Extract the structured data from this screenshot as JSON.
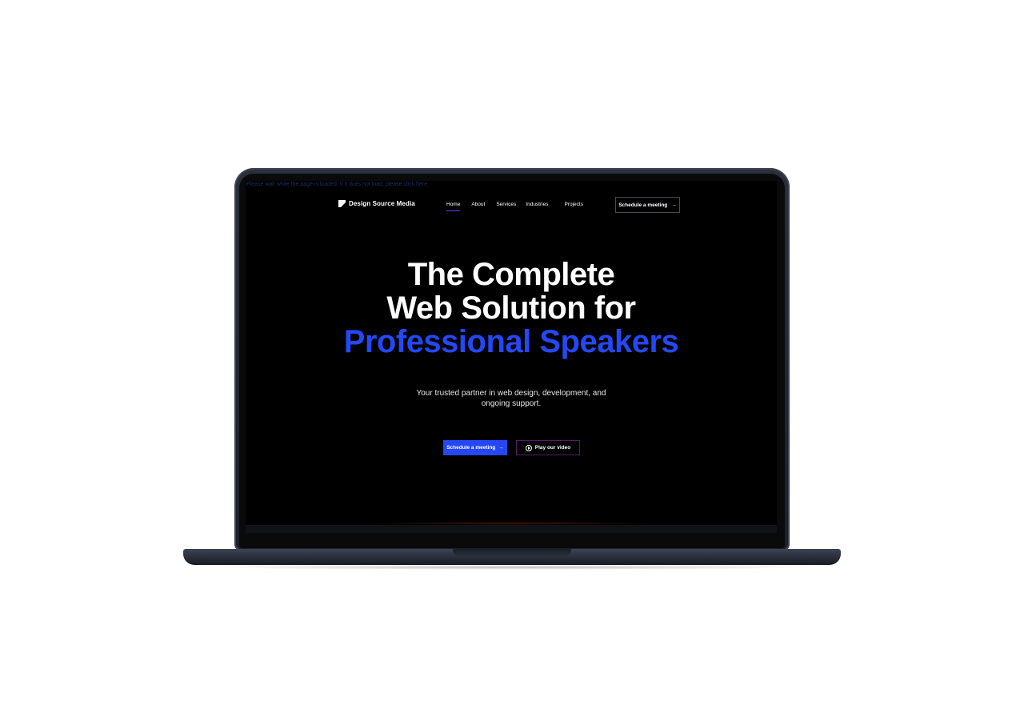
{
  "notice": "Please wait while the page is loaded. If it does not load, please click here.",
  "brand": {
    "name": "Design Source Media",
    "logo_icon": "logo-mark-icon"
  },
  "nav": {
    "items": [
      {
        "label": "Home",
        "active": true
      },
      {
        "label": "About",
        "active": false
      },
      {
        "label": "Services",
        "active": false
      },
      {
        "label": "Industries",
        "active": false
      },
      {
        "label": "Projects",
        "active": false
      }
    ],
    "cta_label": "Schedule a meeting",
    "cta_arrow": "→"
  },
  "hero": {
    "line1": "The Complete",
    "line2": "Web Solution for",
    "line3": "Professional Speakers",
    "subtitle": "Your trusted partner in web design, development, and ongoing support.",
    "primary_button": "Schedule a meeting",
    "primary_arrow": "→",
    "secondary_button": "Play our video"
  },
  "colors": {
    "accent_blue": "#2448f5",
    "nav_underline": "#7b2ff7",
    "secondary_border": "#5a1a6e",
    "background": "#000000"
  }
}
